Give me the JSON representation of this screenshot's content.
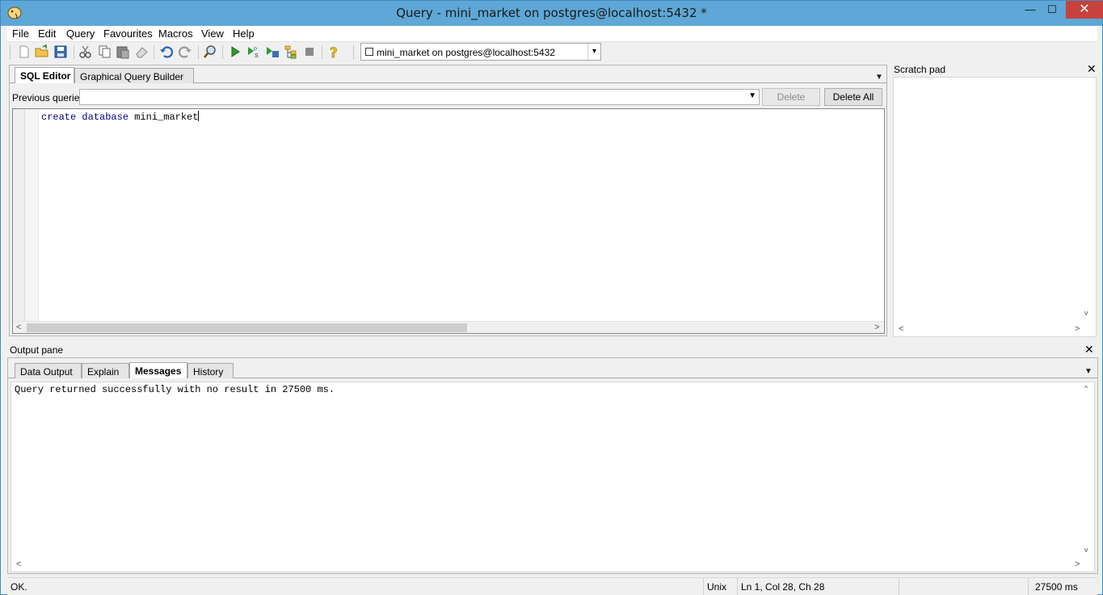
{
  "window": {
    "title": "Query - mini_market on postgres@localhost:5432 *",
    "minimize": "—",
    "maximize": "☐",
    "close": "✕"
  },
  "menu": [
    "File",
    "Edit",
    "Query",
    "Favourites",
    "Macros",
    "View",
    "Help"
  ],
  "toolbar": {
    "connection": "mini_market on postgres@localhost:5432",
    "connection_arrow": "▾"
  },
  "editor": {
    "tabs": [
      "SQL Editor",
      "Graphical Query Builder"
    ],
    "menu_arrow": "▼",
    "previous_queries_label": "Previous queries",
    "previous_queries_value": "",
    "delete_label": "Delete",
    "delete_all_label": "Delete All",
    "code": {
      "kw1": "create",
      "kw2": "database",
      "name": "mini_market"
    }
  },
  "scratch": {
    "title": "Scratch pad",
    "close": "✕"
  },
  "output": {
    "title": "Output pane",
    "close": "✕",
    "tabs": [
      "Data Output",
      "Explain",
      "Messages",
      "History"
    ],
    "active_tab": "Messages",
    "menu_arrow": "▼",
    "message": "Query returned successfully with no result in 27500 ms."
  },
  "status": {
    "left": "OK.",
    "line_ending": "Unix",
    "position": "Ln 1, Col 28, Ch 28",
    "timing": "27500 ms"
  },
  "scroll": {
    "left": "<",
    "right": ">",
    "up": "^",
    "down": "v"
  },
  "colors": {
    "titlebar": "#5ea7d6",
    "close_button": "#c7423b"
  }
}
